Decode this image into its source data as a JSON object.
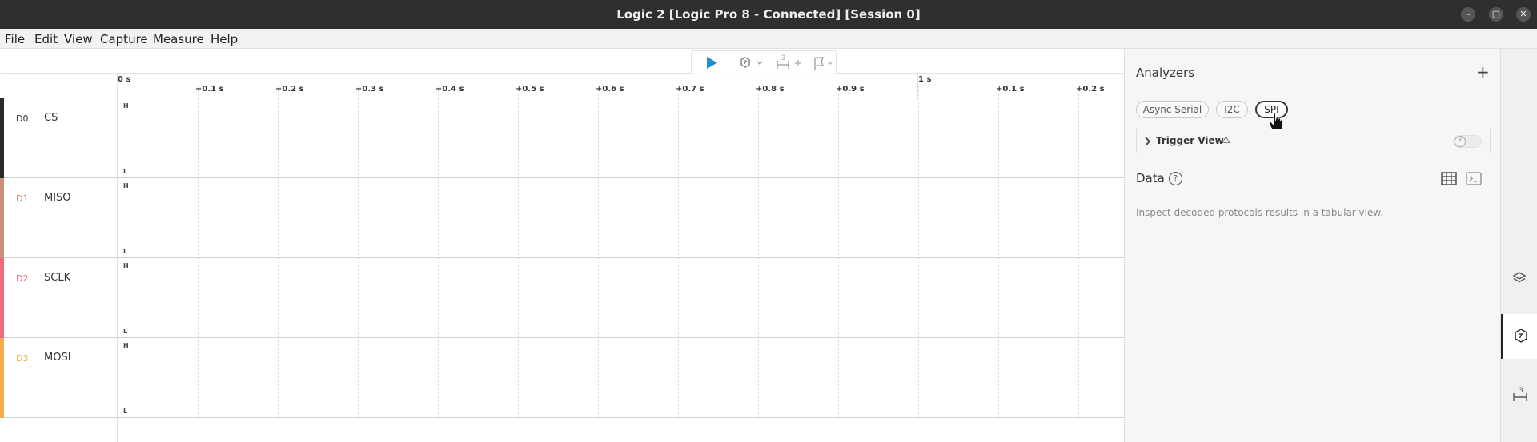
{
  "window": {
    "title": "Logic 2 [Logic Pro 8 - Connected] [Session 0]"
  },
  "menu": [
    "File",
    "Edit",
    "View",
    "Capture",
    "Measure",
    "Help"
  ],
  "toolbar": {
    "measure_count": "3"
  },
  "timeline": {
    "ticks": [
      "0 s",
      "+0.1 s",
      "+0.2 s",
      "+0.3 s",
      "+0.4 s",
      "+0.5 s",
      "+0.6 s",
      "+0.7 s",
      "+0.8 s",
      "+0.9 s",
      "1 s",
      "+0.1 s",
      "+0.2 s"
    ],
    "high_label": "H",
    "low_label": "L"
  },
  "channels": [
    {
      "id": "D0",
      "name": "CS",
      "color": "#2a2a2a",
      "id_color": "#333333"
    },
    {
      "id": "D1",
      "name": "MISO",
      "color": "#c9907a",
      "id_color": "#c9907a"
    },
    {
      "id": "D2",
      "name": "SCLK",
      "color": "#f06a7e",
      "id_color": "#f06a7e"
    },
    {
      "id": "D3",
      "name": "MOSI",
      "color": "#f5ad4c",
      "id_color": "#f5ad4c"
    }
  ],
  "analyzers": {
    "title": "Analyzers",
    "add_icon": "+",
    "chips": [
      "Async Serial",
      "I2C",
      "SPI"
    ],
    "selected_chip": "SPI",
    "trigger_view_label": "Trigger View",
    "trigger_warning_icon": "⚠"
  },
  "data_section": {
    "title": "Data",
    "help_icon": "?",
    "hint": "Inspect decoded protocols results in a tabular view."
  },
  "rail": {
    "timing_count": "3"
  }
}
